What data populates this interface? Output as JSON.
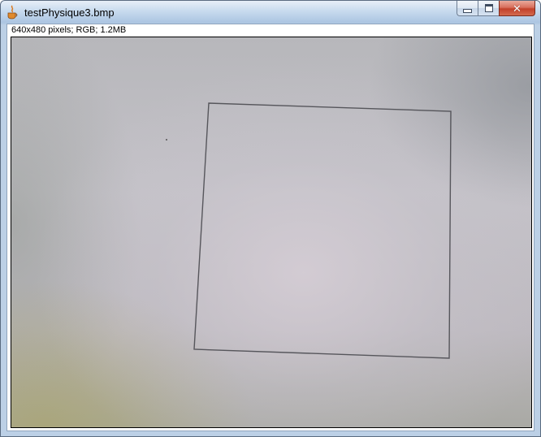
{
  "window": {
    "title": "testPhysique3.bmp",
    "app_icon": "java-coffee-cup-icon",
    "buttons": {
      "minimize": "minimize-icon",
      "maximize": "maximize-icon",
      "close": "close-icon"
    }
  },
  "image_info": "640x480 pixels; RGB; 1.2MB",
  "colors": {
    "close_button": "#c2412a",
    "frame": "#b4cbe4",
    "drawn_square_line": "#4a4a50"
  }
}
